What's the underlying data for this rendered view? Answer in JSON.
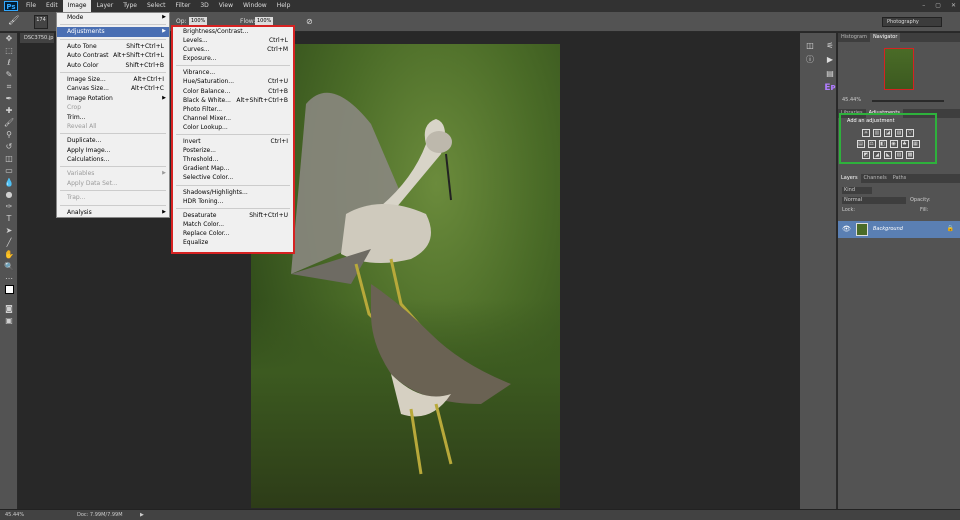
{
  "menubar": {
    "logo": "Ps",
    "items": [
      "File",
      "Edit",
      "Image",
      "Layer",
      "Type",
      "Select",
      "Filter",
      "3D",
      "View",
      "Window",
      "Help"
    ],
    "active": "Image",
    "window_buttons": [
      "–",
      "▢",
      "✕"
    ]
  },
  "options_bar": {
    "brush_size": "174",
    "mode_value": "100%",
    "flow_label": "Flow:",
    "flow_value": "100%",
    "opacity_frag": "Op:",
    "workspace": "Photography"
  },
  "document": {
    "tab": "DSC3750.jp",
    "zoom": "45.44%",
    "doc_size": "Doc: 7.99M/7.99M"
  },
  "image_menu": {
    "items": [
      {
        "label": "Mode",
        "shortcut": "",
        "submenu": true,
        "disabled": false,
        "highlight": false
      },
      {
        "sep": true
      },
      {
        "label": "Adjustments",
        "shortcut": "",
        "submenu": true,
        "disabled": false,
        "highlight": true
      },
      {
        "sep": true
      },
      {
        "label": "Auto Tone",
        "shortcut": "Shift+Ctrl+L",
        "submenu": false,
        "disabled": false,
        "highlight": false
      },
      {
        "label": "Auto Contrast",
        "shortcut": "Alt+Shift+Ctrl+L",
        "submenu": false,
        "disabled": false,
        "highlight": false
      },
      {
        "label": "Auto Color",
        "shortcut": "Shift+Ctrl+B",
        "submenu": false,
        "disabled": false,
        "highlight": false
      },
      {
        "sep": true
      },
      {
        "label": "Image Size...",
        "shortcut": "Alt+Ctrl+I",
        "submenu": false,
        "disabled": false,
        "highlight": false
      },
      {
        "label": "Canvas Size...",
        "shortcut": "Alt+Ctrl+C",
        "submenu": false,
        "disabled": false,
        "highlight": false
      },
      {
        "label": "Image Rotation",
        "shortcut": "",
        "submenu": true,
        "disabled": false,
        "highlight": false
      },
      {
        "label": "Crop",
        "shortcut": "",
        "submenu": false,
        "disabled": true,
        "highlight": false
      },
      {
        "label": "Trim...",
        "shortcut": "",
        "submenu": false,
        "disabled": false,
        "highlight": false
      },
      {
        "label": "Reveal All",
        "shortcut": "",
        "submenu": false,
        "disabled": true,
        "highlight": false
      },
      {
        "sep": true
      },
      {
        "label": "Duplicate...",
        "shortcut": "",
        "submenu": false,
        "disabled": false,
        "highlight": false
      },
      {
        "label": "Apply Image...",
        "shortcut": "",
        "submenu": false,
        "disabled": false,
        "highlight": false
      },
      {
        "label": "Calculations...",
        "shortcut": "",
        "submenu": false,
        "disabled": false,
        "highlight": false
      },
      {
        "sep": true
      },
      {
        "label": "Variables",
        "shortcut": "",
        "submenu": true,
        "disabled": true,
        "highlight": false
      },
      {
        "label": "Apply Data Set...",
        "shortcut": "",
        "submenu": false,
        "disabled": true,
        "highlight": false
      },
      {
        "sep": true
      },
      {
        "label": "Trap...",
        "shortcut": "",
        "submenu": false,
        "disabled": true,
        "highlight": false
      },
      {
        "sep": true
      },
      {
        "label": "Analysis",
        "shortcut": "",
        "submenu": true,
        "disabled": false,
        "highlight": false
      }
    ]
  },
  "adjustments_menu": {
    "items": [
      {
        "label": "Brightness/Contrast...",
        "shortcut": ""
      },
      {
        "label": "Levels...",
        "shortcut": "Ctrl+L"
      },
      {
        "label": "Curves...",
        "shortcut": "Ctrl+M"
      },
      {
        "label": "Exposure...",
        "shortcut": ""
      },
      {
        "sep": true
      },
      {
        "label": "Vibrance...",
        "shortcut": ""
      },
      {
        "label": "Hue/Saturation...",
        "shortcut": "Ctrl+U"
      },
      {
        "label": "Color Balance...",
        "shortcut": "Ctrl+B"
      },
      {
        "label": "Black & White...",
        "shortcut": "Alt+Shift+Ctrl+B"
      },
      {
        "label": "Photo Filter...",
        "shortcut": ""
      },
      {
        "label": "Channel Mixer...",
        "shortcut": ""
      },
      {
        "label": "Color Lookup...",
        "shortcut": ""
      },
      {
        "sep": true
      },
      {
        "label": "Invert",
        "shortcut": "Ctrl+I"
      },
      {
        "label": "Posterize...",
        "shortcut": ""
      },
      {
        "label": "Threshold...",
        "shortcut": ""
      },
      {
        "label": "Gradient Map...",
        "shortcut": ""
      },
      {
        "label": "Selective Color...",
        "shortcut": ""
      },
      {
        "sep": true
      },
      {
        "label": "Shadows/Highlights...",
        "shortcut": ""
      },
      {
        "label": "HDR Toning...",
        "shortcut": ""
      },
      {
        "sep": true
      },
      {
        "label": "Desaturate",
        "shortcut": "Shift+Ctrl+U"
      },
      {
        "label": "Match Color...",
        "shortcut": ""
      },
      {
        "label": "Replace Color...",
        "shortcut": ""
      },
      {
        "label": "Equalize",
        "shortcut": ""
      }
    ]
  },
  "panels": {
    "navigator_tabs": [
      "Histogram",
      "Navigator"
    ],
    "navigator_zoom": "45.44%",
    "adjustments_tabs": [
      "Libraries",
      "Adjustments"
    ],
    "adjustments_title": "Add an adjustment",
    "adjustment_icons_row1": [
      "☀",
      "▥",
      "◪",
      "▨",
      "▽"
    ],
    "adjustment_icons_row2": [
      "▤",
      "⚖",
      "◧",
      "◉",
      "♣",
      "▦"
    ],
    "adjustment_icons_row3": [
      "◩",
      "◢",
      "◣",
      "▧",
      "▩"
    ],
    "layers_tabs": [
      "Layers",
      "Channels",
      "Paths"
    ],
    "layers_kind": "Kind",
    "blend_mode": "Normal",
    "opacity_label": "Opacity:",
    "lock_label": "Lock:",
    "fill_label": "Fill:",
    "layer_name": "Background"
  },
  "colors": {
    "red_outline": "#d62222",
    "green_outline": "#2eb13c",
    "menu_highlight": "#4a6fb3"
  }
}
